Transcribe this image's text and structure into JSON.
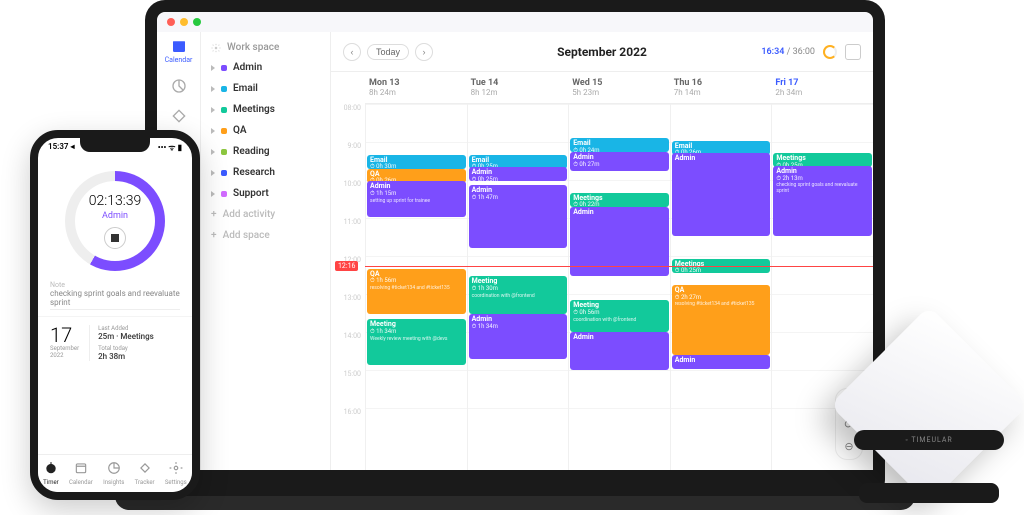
{
  "colors": {
    "email": "#19b5e6",
    "admin": "#7c4dff",
    "meetings": "#12c99b",
    "meeting": "#12c99b",
    "qa": "#ff9f1a",
    "reading": "#8cc63f",
    "research": "#3b5bff",
    "support": "#d16bff"
  },
  "rail": {
    "calendar": "Calendar"
  },
  "sidebar": {
    "workspace": "Work space",
    "items": [
      {
        "label": "Admin",
        "colorKey": "admin"
      },
      {
        "label": "Email",
        "colorKey": "email"
      },
      {
        "label": "Meetings",
        "colorKey": "meetings"
      },
      {
        "label": "QA",
        "colorKey": "qa"
      },
      {
        "label": "Reading",
        "colorKey": "reading"
      },
      {
        "label": "Research",
        "colorKey": "research"
      },
      {
        "label": "Support",
        "colorKey": "support"
      }
    ],
    "addActivity": "Add activity",
    "addSpace": "Add space"
  },
  "topbar": {
    "today": "Today",
    "month": "September 2022",
    "currentTime": "16:34",
    "totalTime": "36:00"
  },
  "nowLabel": "12:16",
  "days": [
    {
      "name": "Mon 13",
      "duration": "8h 24m",
      "today": false
    },
    {
      "name": "Tue 14",
      "duration": "8h 12m",
      "today": false
    },
    {
      "name": "Wed 15",
      "duration": "5h 23m",
      "today": false
    },
    {
      "name": "Thu 16",
      "duration": "7h 14m",
      "today": false
    },
    {
      "name": "Fri 17",
      "duration": "2h 34m",
      "today": true
    }
  ],
  "hours": [
    "08:00",
    "9:00",
    "10:00",
    "11:00",
    "12:00",
    "13:00",
    "14:00",
    "15:00",
    "16:00"
  ],
  "blocks": {
    "0": [
      {
        "title": "Email",
        "dur": "0h 30m",
        "colorKey": "email",
        "startMin": 80,
        "len": 22
      },
      {
        "title": "QA",
        "dur": "0h 26m",
        "colorKey": "qa",
        "startMin": 102,
        "len": 20
      },
      {
        "title": "Admin",
        "dur": "1h 15m",
        "note": "setting up sprint for trainee",
        "colorKey": "admin",
        "startMin": 122,
        "len": 56
      },
      {
        "title": "QA",
        "dur": "1h 56m",
        "note": "resolving #ticket134 and #ticket135",
        "colorKey": "qa",
        "startMin": 260,
        "len": 72
      },
      {
        "title": "Meeting",
        "dur": "1h 34m",
        "note": "Weekly review meeting with @devs",
        "colorKey": "meeting",
        "startMin": 340,
        "len": 72
      }
    ],
    "1": [
      {
        "title": "Email",
        "dur": "0h 25m",
        "colorKey": "email",
        "startMin": 80,
        "len": 20
      },
      {
        "title": "Admin",
        "dur": "0h 25m",
        "colorKey": "admin",
        "startMin": 100,
        "len": 22
      },
      {
        "title": "Admin",
        "dur": "1h 47m",
        "colorKey": "admin",
        "startMin": 128,
        "len": 100
      },
      {
        "title": "Meeting",
        "dur": "1h 30m",
        "note": "coordination with @frontend",
        "colorKey": "meeting",
        "startMin": 272,
        "len": 60
      },
      {
        "title": "Admin",
        "dur": "1h 34m",
        "colorKey": "admin",
        "startMin": 332,
        "len": 70
      }
    ],
    "2": [
      {
        "title": "Email",
        "dur": "0h 24m",
        "colorKey": "email",
        "startMin": 54,
        "len": 22
      },
      {
        "title": "Admin",
        "dur": "0h 27m",
        "colorKey": "admin",
        "startMin": 76,
        "len": 30
      },
      {
        "title": "Meetings",
        "dur": "0h 22m",
        "colorKey": "meetings",
        "startMin": 140,
        "len": 22
      },
      {
        "title": "Admin",
        "dur": "",
        "colorKey": "admin",
        "startMin": 162,
        "len": 110
      },
      {
        "title": "Meeting",
        "dur": "0h 56m",
        "note": "coordination with @frontend",
        "colorKey": "meeting",
        "startMin": 310,
        "len": 50
      },
      {
        "title": "Admin",
        "dur": "",
        "colorKey": "admin",
        "startMin": 360,
        "len": 60
      }
    ],
    "3": [
      {
        "title": "Email",
        "dur": "0h 26m",
        "colorKey": "email",
        "startMin": 58,
        "len": 20
      },
      {
        "title": "Admin",
        "dur": "",
        "colorKey": "admin",
        "startMin": 78,
        "len": 130
      },
      {
        "title": "Meetings",
        "dur": "0h 25m",
        "colorKey": "meetings",
        "startMin": 244,
        "len": 22
      },
      {
        "title": "QA",
        "dur": "2h 27m",
        "note": "resolving #ticket134 and #ticket135",
        "colorKey": "qa",
        "startMin": 286,
        "len": 110
      },
      {
        "title": "Admin",
        "dur": "",
        "colorKey": "admin",
        "startMin": 396,
        "len": 20
      }
    ],
    "4": [
      {
        "title": "Meetings",
        "dur": "0h 25m",
        "colorKey": "meetings",
        "startMin": 78,
        "len": 20
      },
      {
        "title": "Admin",
        "dur": "2h 13m",
        "note": "checking sprint goals and reevaluate sprint",
        "colorKey": "admin",
        "startMin": 98,
        "len": 110
      }
    ]
  },
  "phone": {
    "statusTime": "15:37 ◂",
    "timer": "02:13:39",
    "activity": "Admin",
    "noteLabel": "Note",
    "noteText": "checking sprint goals and reevaluate sprint",
    "dayNum": "17",
    "dayMonth": "September",
    "dayYear": "2022",
    "lastAddedLabel": "Last Added",
    "lastAddedValue": "25m · Meetings",
    "totalTodayLabel": "Total today",
    "totalTodayValue": "2h 38m",
    "tabs": [
      "Timer",
      "Calendar",
      "Insights",
      "Tracker",
      "Settings"
    ]
  },
  "device": {
    "brand": "◦ TIMEULAR"
  }
}
